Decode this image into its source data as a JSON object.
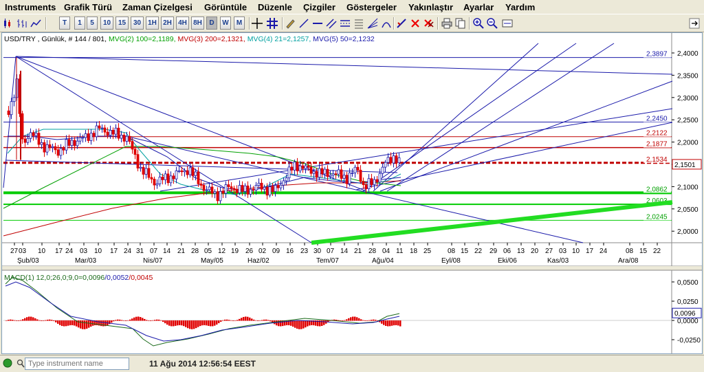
{
  "menu": [
    "Instruments",
    "Grafik Türü",
    "Zaman Çizelgesi",
    "Görüntüle",
    "Düzenle",
    "Çizgiler",
    "Göstergeler",
    "Yakınlaştır",
    "Ayarlar",
    "Yardım"
  ],
  "toolbar": {
    "timeframes": [
      "T",
      "1",
      "5",
      "10",
      "15",
      "30",
      "1H",
      "2H",
      "4H",
      "8H",
      "D",
      "W",
      "M"
    ],
    "active_timeframe": "D",
    "pin_label": "pin-icon"
  },
  "chart": {
    "header": {
      "symbol": "USD/TRY , Günlük, # 144 / 801,",
      "mvg2": "MVG(2) 100=2,1189,",
      "mvg3": "MVG(3) 200=2,1321,",
      "mvg4": "MVG(4) 21=2,1257,",
      "mvg5": "MVG(5) 50=2,1232"
    },
    "colors": {
      "mvg2": "#00a000",
      "mvg3": "#c00000",
      "mvg4": "#00a0a0",
      "mvg5": "#1a1aaa",
      "up": "#1a1aaa",
      "down": "#e00000"
    },
    "price_axis": [
      "2,4000",
      "2,3500",
      "2,3000",
      "2,2500",
      "2,2000",
      "2,1500",
      "2,1000",
      "2,0500",
      "2,0000"
    ],
    "level_labels": [
      {
        "text": "2,3897",
        "color": "#1a1aaa"
      },
      {
        "text": "2,2450",
        "color": "#1a1aaa"
      },
      {
        "text": "2,2122",
        "color": "#c00000"
      },
      {
        "text": "2,1877",
        "color": "#c00000"
      },
      {
        "text": "2,1534",
        "color": "#c00000"
      },
      {
        "text": "2,0862",
        "color": "#00a000"
      },
      {
        "text": "2,0603",
        "color": "#00a000"
      },
      {
        "text": "2,0245",
        "color": "#00a000"
      }
    ],
    "current_price": "2,1501",
    "date_days": [
      "27",
      "03",
      "10",
      "17",
      "24",
      "03",
      "10",
      "17",
      "24",
      "31",
      "07",
      "14",
      "21",
      "28",
      "05",
      "12",
      "19",
      "26",
      "02",
      "09",
      "16",
      "23",
      "30",
      "07",
      "14",
      "21",
      "28",
      "04",
      "11",
      "18",
      "25",
      "08",
      "15",
      "22",
      "29",
      "06",
      "13",
      "20",
      "27",
      "03",
      "10",
      "17",
      "24",
      "08",
      "15",
      "22"
    ],
    "date_months": [
      "Şub/03",
      "Mar/03",
      "Nis/07",
      "May/05",
      "Haz/02",
      "Tem/07",
      "Ağu/04",
      "Eyl/08",
      "Eki/06",
      "Kas/03",
      "Ara/08"
    ]
  },
  "macd": {
    "header": "MACD(1) 12,0;26,0;9,0=",
    "v1": "0,0096",
    "v2": "/0,0052",
    "v3": "/0,0045",
    "axis": [
      "0,0500",
      "0,0250",
      "0,0000",
      "-0,0250"
    ],
    "current": "0,0096"
  },
  "status": {
    "placeholder": "Type instrument name",
    "datetime": "11 Ağu 2014 12:56:54 EEST"
  }
}
